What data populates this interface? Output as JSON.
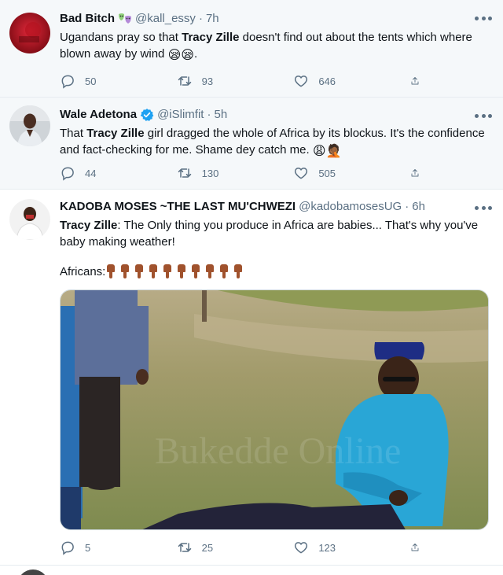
{
  "tweets": [
    {
      "display_name": "Bad Bitch",
      "handle": "@kall_essy",
      "time": "7h",
      "text_before": "Ugandans pray so that ",
      "text_bold": "Tracy Zille",
      "text_after": " doesn't find out about the tents  which where blown away by wind ",
      "text_end": ".",
      "emojis": "😪😪",
      "replies": "50",
      "retweets": "93",
      "likes": "646"
    },
    {
      "display_name": "Wale Adetona",
      "handle": "@iSlimfit",
      "time": "5h",
      "verified": true,
      "text_before": "That ",
      "text_bold": "Tracy Zille",
      "text_after": " girl dragged the whole of Africa by its blockus. It's the confidence and fact-checking for me. Shame dey catch me. ",
      "emojis": "😩🤦🏾",
      "replies": "44",
      "retweets": "130",
      "likes": "505"
    },
    {
      "display_name": "KADOBA MOSES ~THE LAST MU'CHWEZI",
      "handle": "@kadobamosesUG",
      "time": "6h",
      "text_bold": "Tracy Zille",
      "text_after": ": The Only thing you produce in Africa are babies... That's why you've baby making weather!",
      "text_line2": "Africans:",
      "hand_count": 10,
      "replies": "5",
      "retweets": "25",
      "likes": "123"
    }
  ],
  "separator": "·",
  "colors": {
    "secondary_text": "#5b7083",
    "verified_blue": "#1da1f2",
    "highlight_bg": "#f5f8fa",
    "divider": "#e6ecf0"
  },
  "icons": [
    "reply-icon",
    "retweet-icon",
    "like-icon",
    "share-icon",
    "more-icon",
    "verified-badge-icon",
    "mask-emoji-icon"
  ]
}
